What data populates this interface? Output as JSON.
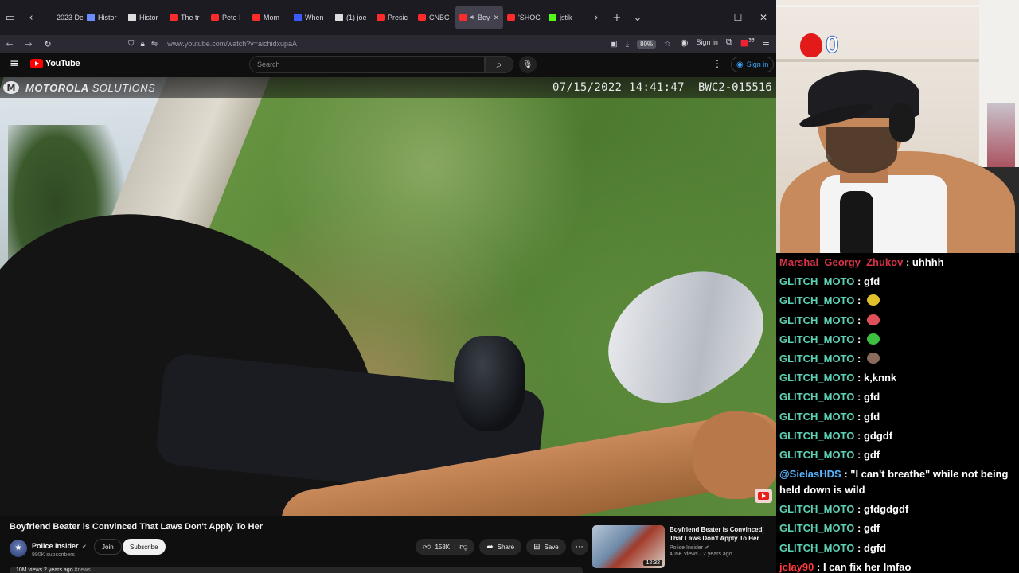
{
  "browser": {
    "tabs": [
      {
        "label": "2023 Dem",
        "icon": "list-icon",
        "color": "#888888"
      },
      {
        "label": "Histor",
        "icon": "globe-icon",
        "color": "#6a8cff"
      },
      {
        "label": "Histor",
        "icon": "wikipedia-icon",
        "color": "#dddddd"
      },
      {
        "label": "The tr",
        "icon": "youtube-icon",
        "color": "#ff2a2a"
      },
      {
        "label": "Pete I",
        "icon": "youtube-icon",
        "color": "#ff2a2a"
      },
      {
        "label": "Mom",
        "icon": "youtube-icon",
        "color": "#ff2a2a"
      },
      {
        "label": "When",
        "icon": "pause-icon",
        "color": "#3b5bff"
      },
      {
        "label": "(1) joe",
        "icon": "x-icon",
        "color": "#dddddd"
      },
      {
        "label": "Presic",
        "icon": "youtube-icon",
        "color": "#ff2a2a"
      },
      {
        "label": "CNBC",
        "icon": "youtube-icon",
        "color": "#ff2a2a"
      },
      {
        "label": "Boy",
        "icon": "youtube-icon",
        "color": "#ff2a2a",
        "active": true
      },
      {
        "label": "'SHOC",
        "icon": "youtube-icon",
        "color": "#ff2a2a"
      },
      {
        "label": "jstik",
        "icon": "kick-icon",
        "color": "#53fc18"
      }
    ],
    "url": "www.youtube.com/watch?v=aichidxupaA",
    "zoom": "80%",
    "signin": "Sign in",
    "badge_count": "33"
  },
  "youtube": {
    "logo_text": "YouTube",
    "search_placeholder": "Search",
    "signin": "Sign in"
  },
  "video": {
    "brand_bold": "MOTOROLA",
    "brand_rest": "SOLUTIONS",
    "timestamp": "07/15/2022 14:41:47",
    "camera_id": "BWC2-015516",
    "title": "Boyfriend Beater is Convinced That Laws Don't Apply To Her",
    "channel": "Police Insider",
    "subscribers": "990K subscribers",
    "join": "Join",
    "subscribe": "Subscribe",
    "likes": "158K",
    "share": "Share",
    "save": "Save",
    "meta": "10M views  2 years ago",
    "meta_tag": "#news"
  },
  "recommended": {
    "title": "Boyfriend Beater is Convinced That Laws Don't Apply To Her ...",
    "channel": "Police Insider",
    "views": "405K views · 2 years ago",
    "duration": "12:32"
  },
  "stream": {
    "heart_counter": "0"
  },
  "chat": {
    "messages": [
      {
        "user": "Marshal_Georgy_Zhukov",
        "color": "#d7344a",
        "text": "uhhhh"
      },
      {
        "user": "GLITCH_MOTO",
        "color": "#5cd0b5",
        "text": "gfd"
      },
      {
        "user": "GLITCH_MOTO",
        "color": "#5cd0b5",
        "text": "",
        "emote": "#e2c12b"
      },
      {
        "user": "GLITCH_MOTO",
        "color": "#5cd0b5",
        "text": "",
        "emote": "#e0505a"
      },
      {
        "user": "GLITCH_MOTO",
        "color": "#5cd0b5",
        "text": "",
        "emote": "#3fbf3f"
      },
      {
        "user": "GLITCH_MOTO",
        "color": "#5cd0b5",
        "text": "",
        "emote": "#8a6a5a"
      },
      {
        "user": "GLITCH_MOTO",
        "color": "#5cd0b5",
        "text": "k,knnk"
      },
      {
        "user": "GLITCH_MOTO",
        "color": "#5cd0b5",
        "text": "gfd"
      },
      {
        "user": "GLITCH_MOTO",
        "color": "#5cd0b5",
        "text": "gfd"
      },
      {
        "user": "GLITCH_MOTO",
        "color": "#5cd0b5",
        "text": "gdgdf"
      },
      {
        "user": "GLITCH_MOTO",
        "color": "#5cd0b5",
        "text": "gdf"
      },
      {
        "user": "@SielasHDS",
        "color": "#5ab5ff",
        "text": "\"I can't breathe\" while not being held down is wild",
        "wrap": true
      },
      {
        "user": "GLITCH_MOTO",
        "color": "#5cd0b5",
        "text": "gfdgdgdf"
      },
      {
        "user": "GLITCH_MOTO",
        "color": "#5cd0b5",
        "text": "gdf"
      },
      {
        "user": "GLITCH_MOTO",
        "color": "#5cd0b5",
        "text": "dgfd"
      },
      {
        "user": "jclay90",
        "color": "#ff3a3a",
        "text": "I can fix her lmfao"
      }
    ]
  }
}
